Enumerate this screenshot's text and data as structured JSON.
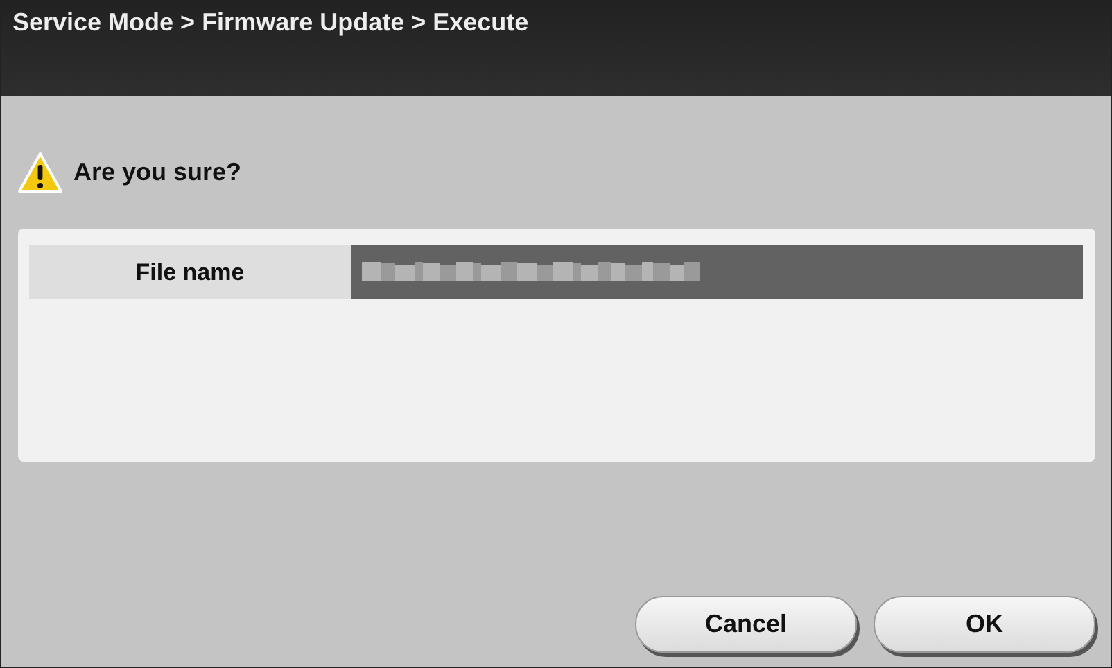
{
  "window": {
    "title": "Service Mode > Firmware Update > Execute"
  },
  "message": {
    "text": "Are you sure?"
  },
  "fields": [
    {
      "label": "File name",
      "value_blurred": true
    }
  ],
  "buttons": [
    "Cancel",
    "OK"
  ]
}
